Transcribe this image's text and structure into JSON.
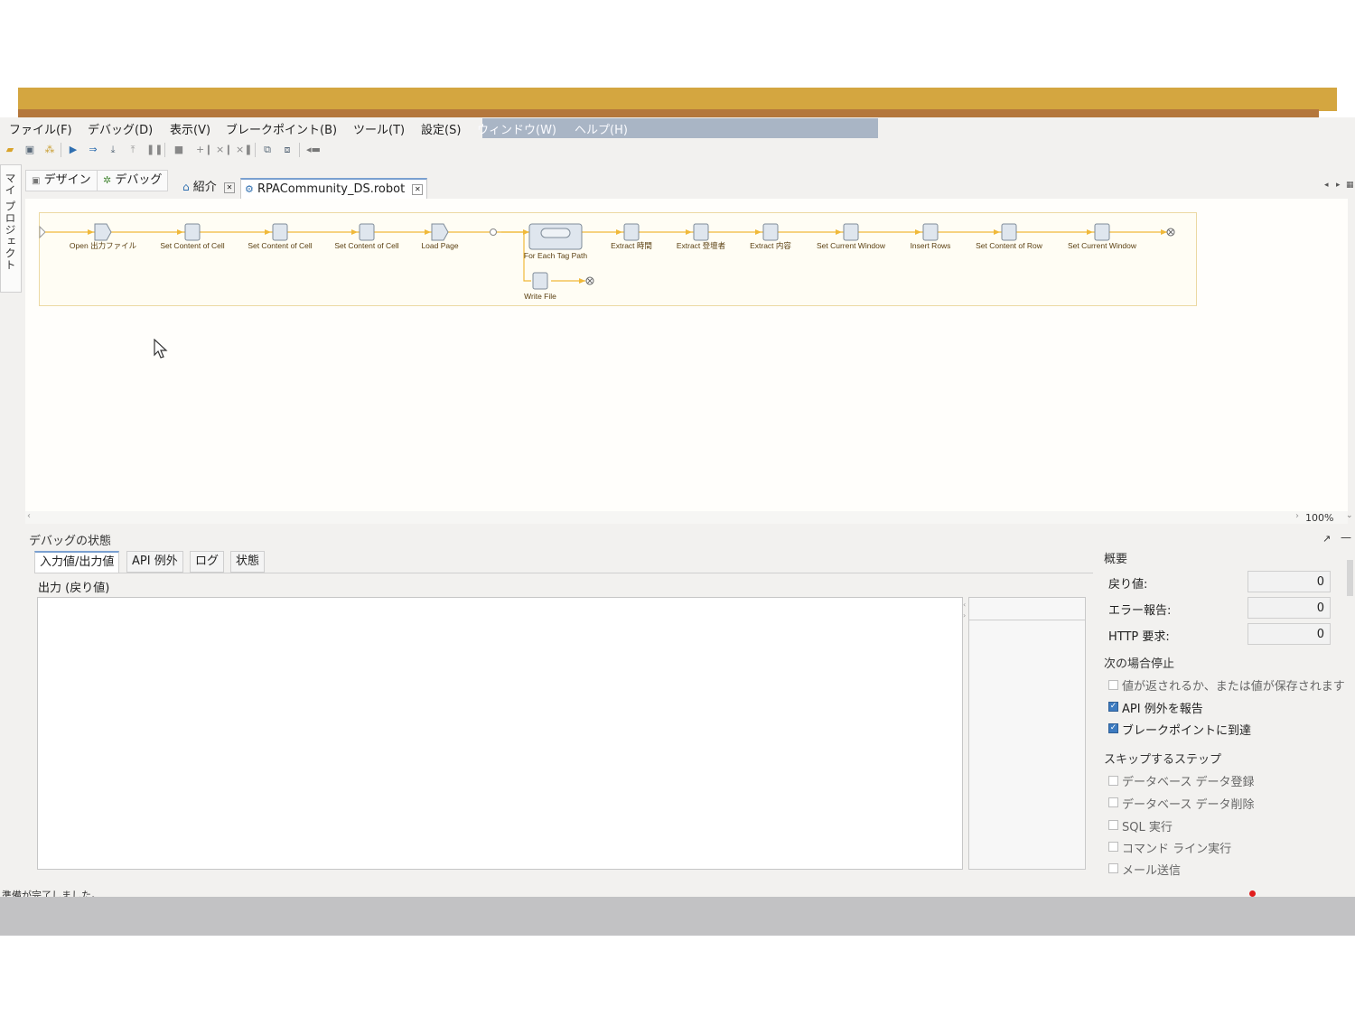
{
  "menu": {
    "items": [
      "ファイル(F)",
      "デバッグ(D)",
      "表示(V)",
      "ブレークポイント(B)",
      "ツール(T)",
      "設定(S)",
      "ウィンドウ(W)",
      "ヘルプ(H)"
    ]
  },
  "sidebar": {
    "label": "マイ プロジェクト"
  },
  "perspectives": {
    "design": "デザイン",
    "debug": "デバッグ"
  },
  "tabs": [
    {
      "label": "紹介",
      "icon": "home-icon"
    },
    {
      "label": "RPACommunity_DS.robot",
      "icon": "robot-icon"
    }
  ],
  "workflow": {
    "main": [
      "Open 出力ファイル",
      "Set Content of Cell",
      "Set Content of Cell",
      "Set Content of Cell",
      "Load Page",
      "For Each Tag Path",
      "Extract 時間",
      "Extract 登壇者",
      "Extract 内容",
      "Set Current Window",
      "Insert Rows",
      "Set Content of Row",
      "Set Current Window"
    ],
    "branch": [
      "Write File"
    ]
  },
  "canvas": {
    "zoom": "100%"
  },
  "debug": {
    "title": "デバッグの状態",
    "tabs": [
      "入力値/出力値",
      "API 例外",
      "ログ",
      "状態"
    ],
    "output_label": "出力 (戻り値)"
  },
  "summary": {
    "title": "概要",
    "rows": [
      {
        "label": "戻り値:",
        "value": "0"
      },
      {
        "label": "エラー報告:",
        "value": "0"
      },
      {
        "label": "HTTP 要求:",
        "value": "0"
      }
    ]
  },
  "stop_conditions": {
    "title": "次の場合停止",
    "items": [
      {
        "label": "値が返されるか、または値が保存されます",
        "checked": false
      },
      {
        "label": "API 例外を報告",
        "checked": true
      },
      {
        "label": "ブレークポイントに到達",
        "checked": true
      }
    ]
  },
  "skip_steps": {
    "title": "スキップするステップ",
    "items": [
      {
        "label": "データベース データ登録",
        "checked": false
      },
      {
        "label": "データベース データ削除",
        "checked": false
      },
      {
        "label": "SQL 実行",
        "checked": false
      },
      {
        "label": "コマンド ライン実行",
        "checked": false
      },
      {
        "label": "メール送信",
        "checked": false
      }
    ]
  },
  "status": {
    "text": "準備が完了しました。"
  },
  "colors": {
    "accent": "#7aa0d0",
    "gold": "#d4a640",
    "flow_line": "#f0b93a",
    "checked": "#3d7bc0"
  }
}
